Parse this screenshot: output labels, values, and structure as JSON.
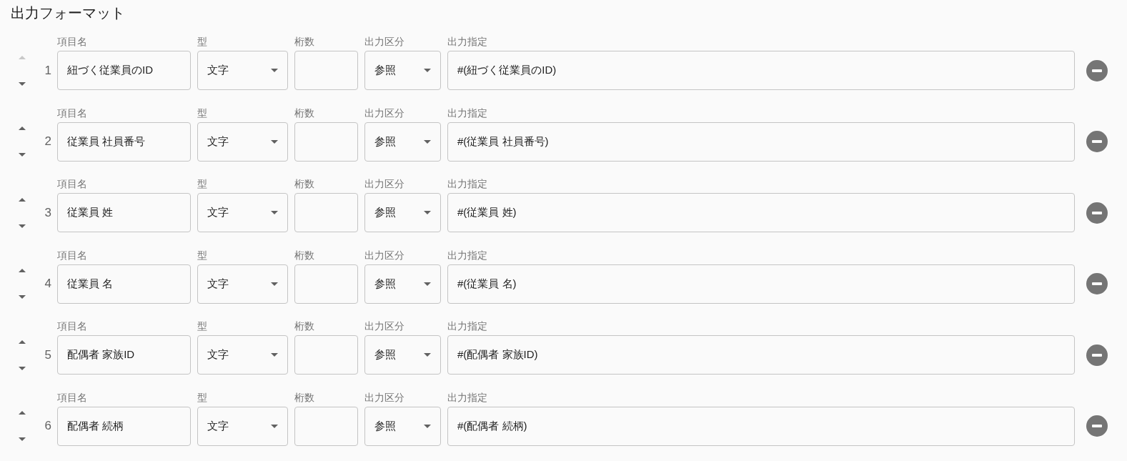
{
  "title": "出力フォーマット",
  "rows": [
    {
      "number": "1",
      "up_disabled": true,
      "fields": [
        {
          "kind": "text",
          "label": "項目名",
          "value": "紐づく従業員のID"
        },
        {
          "kind": "select",
          "label": "型",
          "value": "文字"
        },
        {
          "kind": "text",
          "label": "桁数"
        },
        {
          "kind": "select",
          "label": "出力区分",
          "value": "参照"
        },
        {
          "kind": "text",
          "label": "出力指定",
          "value": "#(紐づく従業員のID)"
        }
      ]
    },
    {
      "number": "2",
      "up_disabled": false,
      "fields": [
        {
          "kind": "text",
          "label": "項目名",
          "value": "従業員 社員番号"
        },
        {
          "kind": "select",
          "label": "型",
          "value": "文字"
        },
        {
          "kind": "text",
          "label": "桁数"
        },
        {
          "kind": "select",
          "label": "出力区分",
          "value": "参照"
        },
        {
          "kind": "text",
          "label": "出力指定",
          "value": "#(従業員 社員番号)"
        }
      ]
    },
    {
      "number": "3",
      "up_disabled": false,
      "fields": [
        {
          "kind": "text",
          "label": "項目名",
          "value": "従業員 姓"
        },
        {
          "kind": "select",
          "label": "型",
          "value": "文字"
        },
        {
          "kind": "text",
          "label": "桁数"
        },
        {
          "kind": "select",
          "label": "出力区分",
          "value": "参照"
        },
        {
          "kind": "text",
          "label": "出力指定",
          "value": "#(従業員 姓)"
        }
      ]
    },
    {
      "number": "4",
      "up_disabled": false,
      "fields": [
        {
          "kind": "text",
          "label": "項目名",
          "value": "従業員 名"
        },
        {
          "kind": "select",
          "label": "型",
          "value": "文字"
        },
        {
          "kind": "text",
          "label": "桁数"
        },
        {
          "kind": "select",
          "label": "出力区分",
          "value": "参照"
        },
        {
          "kind": "text",
          "label": "出力指定",
          "value": "#(従業員 名)"
        }
      ]
    },
    {
      "number": "5",
      "up_disabled": false,
      "fields": [
        {
          "kind": "text",
          "label": "項目名",
          "value": "配偶者 家族ID"
        },
        {
          "kind": "select",
          "label": "型",
          "value": "文字"
        },
        {
          "kind": "text",
          "label": "桁数"
        },
        {
          "kind": "select",
          "label": "出力区分",
          "value": "参照"
        },
        {
          "kind": "text",
          "label": "出力指定",
          "value": "#(配偶者 家族ID)"
        }
      ]
    },
    {
      "number": "6",
      "up_disabled": false,
      "fields": [
        {
          "kind": "text",
          "label": "項目名",
          "value": "配偶者 続柄"
        },
        {
          "kind": "select",
          "label": "型",
          "value": "文字"
        },
        {
          "kind": "text",
          "label": "桁数"
        },
        {
          "kind": "select",
          "label": "出力区分",
          "value": "参照"
        },
        {
          "kind": "text",
          "label": "出力指定",
          "value": "#(配偶者 続柄)"
        }
      ]
    }
  ]
}
